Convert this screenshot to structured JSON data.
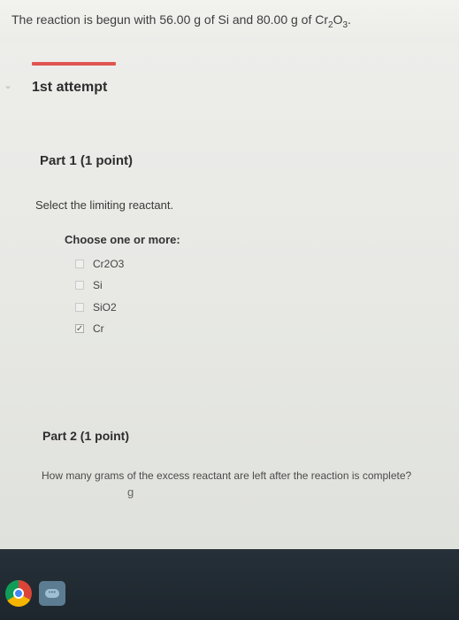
{
  "problem": {
    "prefix": "The reaction is begun with 56.00 g of Si and 80.00 g of Cr",
    "sub1": "2",
    "mid": "O",
    "sub2": "3",
    "suffix": "."
  },
  "attempt": {
    "label": "1st attempt"
  },
  "part1": {
    "title": "Part 1   (1 point)",
    "instruction": "Select the limiting reactant.",
    "choose_label": "Choose one or more:",
    "options": [
      {
        "label": "Cr2O3",
        "checked": false
      },
      {
        "label": "Si",
        "checked": false
      },
      {
        "label": "SiO2",
        "checked": false
      },
      {
        "label": "Cr",
        "checked": true
      }
    ]
  },
  "part2": {
    "title": "Part 2   (1 point)",
    "question": "How many grams of the excess reactant are left after the reaction is complete?",
    "unit": "g",
    "answer_value": ""
  },
  "colors": {
    "accent_line": "#e05550",
    "taskbar": "#263038"
  },
  "icons": {
    "chevron": "chevron-down-icon",
    "check": "checkmark-icon",
    "taskbar": [
      "chrome-icon",
      "chat-icon"
    ]
  }
}
